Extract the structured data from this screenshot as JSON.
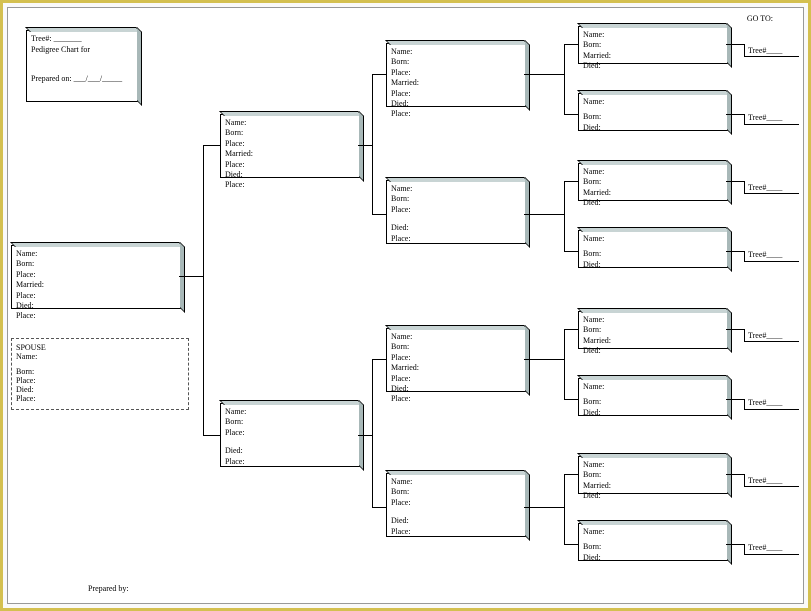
{
  "header": {
    "goto": "GO TO:"
  },
  "titlebox": {
    "tree": "Tree#:",
    "chart_for": "Pedigree Chart for",
    "prepared_on": "Prepared on:",
    "date_sep": "___/___/_____"
  },
  "footer": {
    "prepared_by": "Prepared by:"
  },
  "labels": {
    "name": "Name:",
    "born": "Born:",
    "place": "Place:",
    "married": "Married:",
    "died": "Died:",
    "spouse": "SPOUSE",
    "tree": "Tree#____"
  },
  "gen4_labels": [
    "Name:",
    "Born:",
    "Married:",
    "Died:"
  ],
  "gen4_labels_short": [
    "Name:",
    "",
    "Born:",
    "Died:"
  ]
}
